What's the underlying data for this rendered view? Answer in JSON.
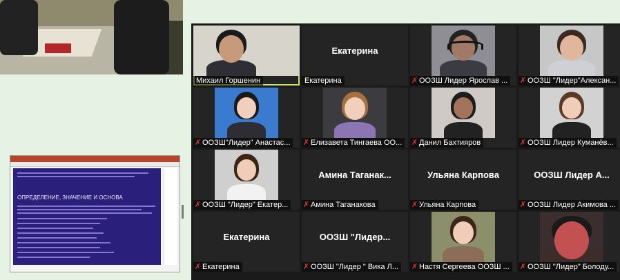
{
  "gallery": {
    "tiles": [
      {
        "name": "Михаил Горшенин",
        "muted": false,
        "video": true,
        "active": true
      },
      {
        "name": "Екатерина",
        "display": "Екатерина",
        "muted": false,
        "video": false
      },
      {
        "name": "ООЗШ Лидер Ярослав ...",
        "muted": true,
        "video": true
      },
      {
        "name": "ООЗШ \"Лидер\"Алексан...",
        "muted": true,
        "video": true
      },
      {
        "name": "ООЗШ\"Лидер\" Анастас...",
        "muted": true,
        "video": true
      },
      {
        "name": "Елизавета Тингаева ОО...",
        "muted": true,
        "video": true
      },
      {
        "name": "Данил Бахтияров",
        "muted": true,
        "video": true
      },
      {
        "name": "ООЗШ Лидер Куманёв...",
        "muted": true,
        "video": true
      },
      {
        "name": "ООЗШ \"Лидер\" Екатер...",
        "muted": true,
        "video": true
      },
      {
        "name": "Амина Таганакова",
        "display": "Амина  Таганак...",
        "muted": true,
        "video": false
      },
      {
        "name": "Ульяна Карпова",
        "display": "Ульяна Карпова",
        "muted": true,
        "video": false
      },
      {
        "name": "ООЗШ Лидер Акимова ...",
        "display": "ООЗШ  Лидер  А...",
        "muted": true,
        "video": false
      },
      {
        "name": "Екатерина",
        "display": "Екатерина",
        "muted": true,
        "video": false
      },
      {
        "name": "ООЗШ \"Лидер \" Вика Л...",
        "display": "ООЗШ  \"Лидер...",
        "muted": true,
        "video": false
      },
      {
        "name": "Настя Сергеева ООЗШ ...",
        "muted": true,
        "video": true
      },
      {
        "name": "ООЗШ \"Лидер\" Болоду...",
        "muted": true,
        "video": true
      }
    ]
  },
  "presentation": {
    "slide_title": "ОПРЕДЕЛЕНИЕ, ЗНАЧЕНИЕ И ОСНОВА"
  },
  "icons": {
    "muted": "muted-mic-icon"
  },
  "colors": {
    "active_border": "#c8e06a",
    "muted_icon": "#e0353a",
    "gallery_bg": "#1a1a1a"
  }
}
